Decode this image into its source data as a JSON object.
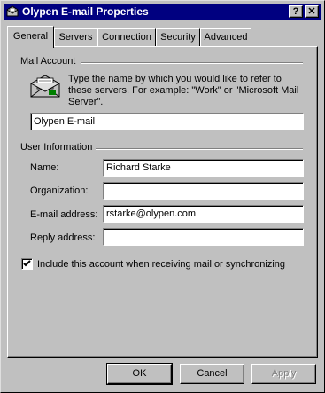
{
  "window": {
    "title": "Olypen E-mail Properties",
    "help_glyph": "?",
    "close_glyph": "✕"
  },
  "tabs": [
    {
      "label": "General",
      "active": true
    },
    {
      "label": "Servers"
    },
    {
      "label": "Connection"
    },
    {
      "label": "Security"
    },
    {
      "label": "Advanced"
    }
  ],
  "mail_account": {
    "group_label": "Mail Account",
    "description": "Type the name by which you would like to refer to these servers.  For example: \"Work\" or \"Microsoft Mail Server\".",
    "account_name": "Olypen E-mail"
  },
  "user_info": {
    "group_label": "User Information",
    "name_label": "Name:",
    "name_value": "Richard Starke",
    "org_label": "Organization:",
    "org_value": "",
    "email_label": "E-mail address:",
    "email_value": "rstarke@olypen.com",
    "reply_label": "Reply address:",
    "reply_value": ""
  },
  "include_checkbox": {
    "label": "Include this account when receiving mail or synchronizing",
    "checked": true
  },
  "buttons": {
    "ok": "OK",
    "cancel": "Cancel",
    "apply": "Apply"
  },
  "icons": {
    "title": "mail-account-icon",
    "account": "envelope-icon"
  },
  "colors": {
    "titlebar": "#000080",
    "face": "#c0c0c0"
  }
}
